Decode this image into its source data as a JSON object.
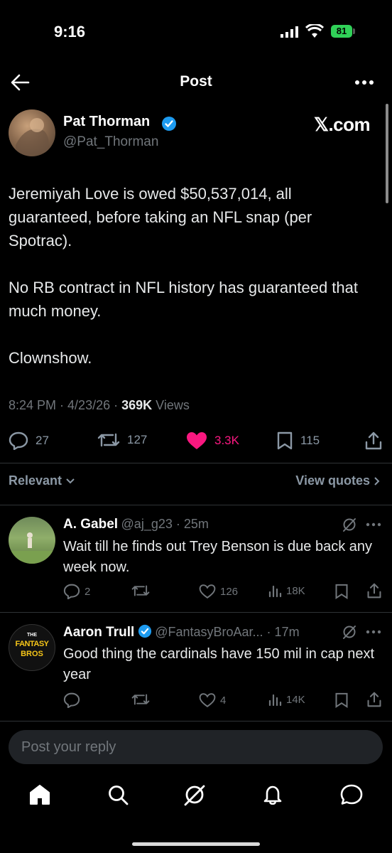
{
  "status": {
    "time": "9:16",
    "battery": "81"
  },
  "header": {
    "title": "Post"
  },
  "post": {
    "name": "Pat Thorman",
    "handle": "@Pat_Thorman",
    "watermark": "𝕏.com",
    "paragraphs": [
      "Jeremiyah Love is owed $50,537,014, all guaranteed, before taking an NFL snap (per Spotrac).",
      "No RB contract in NFL history has guaranteed that much money.",
      "Clownshow."
    ],
    "time": "8:24 PM",
    "date": "4/23/26",
    "views_count": "369K",
    "views_label": "Views",
    "replies": "27",
    "reposts": "127",
    "likes": "3.3K",
    "bookmarks": "115"
  },
  "filter": {
    "sort": "Relevant",
    "view_quotes": "View quotes"
  },
  "replies": [
    {
      "name": "A. Gabel",
      "handle": "@aj_g23",
      "age": "25m",
      "text": "Wait till he finds out Trey Benson is due back any week now.",
      "replies": "2",
      "reposts": "",
      "likes": "126",
      "views": "18K"
    },
    {
      "name": "Aaron Trull",
      "handle": "@FantasyBroAar...",
      "age": "17m",
      "text": "Good thing the cardinals have 150 mil in cap next year",
      "avatar_text_top": "THE",
      "avatar_text_mid": "FANTASY",
      "avatar_text_bot": "BROS",
      "replies": "",
      "reposts": "",
      "likes": "4",
      "views": "14K"
    }
  ],
  "composer": {
    "placeholder": "Post your reply"
  },
  "nav": [
    "home-icon",
    "search-icon",
    "grok-icon",
    "notifications-icon",
    "messages-icon"
  ],
  "colors": {
    "like": "#f91880",
    "verified": "#1d9bf0",
    "battery": "#30d158"
  }
}
